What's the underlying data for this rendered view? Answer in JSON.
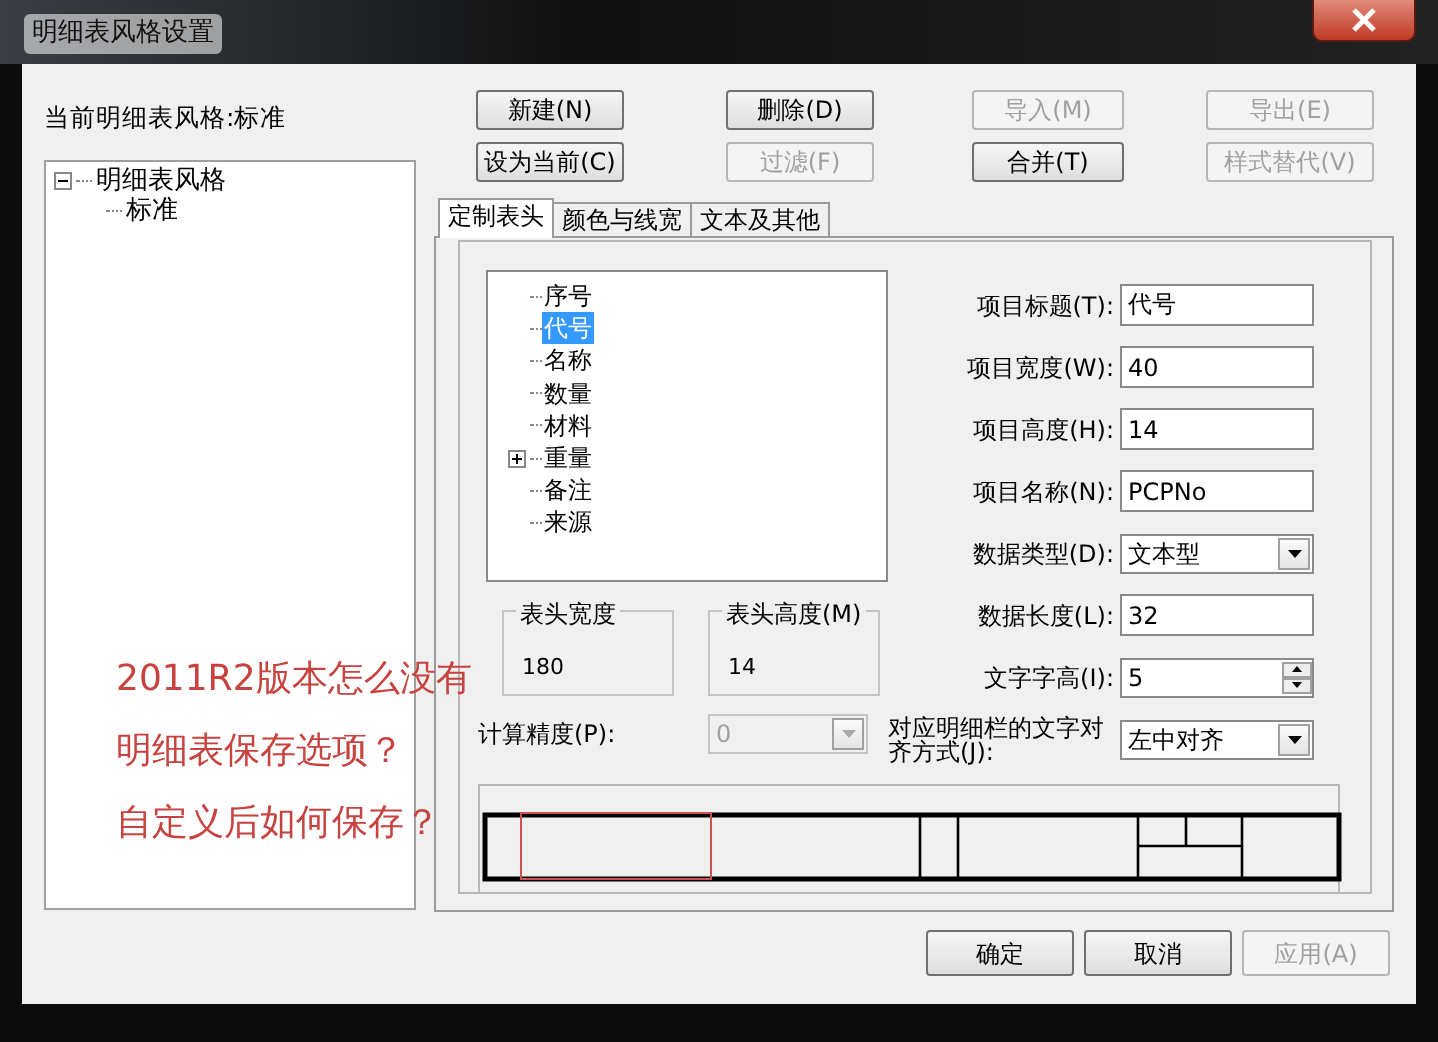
{
  "window": {
    "title": "明细表风格设置"
  },
  "current_style_label": "当前明细表风格:标准",
  "style_tree": [
    {
      "label": "明细表风格",
      "expanded": true,
      "selected": false,
      "children": [
        {
          "label": "标准",
          "selected": false
        }
      ]
    }
  ],
  "toolbar_buttons": [
    {
      "label": "新建(N)",
      "disabled": false
    },
    {
      "label": "删除(D)",
      "disabled": false
    },
    {
      "label": "导入(M)",
      "disabled": true
    },
    {
      "label": "导出(E)",
      "disabled": true
    },
    {
      "label": "设为当前(C)",
      "disabled": false
    },
    {
      "label": "过滤(F)",
      "disabled": true
    },
    {
      "label": "合并(T)",
      "disabled": false
    },
    {
      "label": "样式替代(V)",
      "disabled": true
    }
  ],
  "tabs": [
    {
      "label": "定制表头",
      "selected": true
    },
    {
      "label": "颜色与线宽",
      "selected": false
    },
    {
      "label": "文本及其他",
      "selected": false
    }
  ],
  "field_tree": [
    {
      "label": "序号",
      "selected": false,
      "collapsed": false
    },
    {
      "label": "代号",
      "selected": true,
      "collapsed": false
    },
    {
      "label": "名称",
      "selected": false,
      "collapsed": false
    },
    {
      "label": "数量",
      "selected": false,
      "collapsed": false
    },
    {
      "label": "材料",
      "selected": false,
      "collapsed": false
    },
    {
      "label": "重量",
      "selected": false,
      "collapsed": true
    },
    {
      "label": "备注",
      "selected": false,
      "collapsed": false
    },
    {
      "label": "来源",
      "selected": false,
      "collapsed": false
    }
  ],
  "properties": [
    {
      "kind": "text",
      "label": "项目标题(T):",
      "value": "代号"
    },
    {
      "kind": "text",
      "label": "项目宽度(W):",
      "value": "40"
    },
    {
      "kind": "text",
      "label": "项目高度(H):",
      "value": "14"
    },
    {
      "kind": "text",
      "label": "项目名称(N):",
      "value": "PCPNo"
    },
    {
      "kind": "combo",
      "label": "数据类型(D):",
      "value": "文本型"
    },
    {
      "kind": "text",
      "label": "数据长度(L):",
      "value": "32"
    },
    {
      "kind": "spin",
      "label": "文字字高(I):",
      "value": "5"
    },
    {
      "kind": "combo",
      "label": "对应明细栏的文字对齐方式(J):",
      "value": "左中对齐"
    }
  ],
  "header_width": {
    "label": "表头宽度",
    "value": "180"
  },
  "header_height": {
    "label": "表头高度(M)",
    "value": "14"
  },
  "precision": {
    "label": "计算精度(P):",
    "value": "0",
    "disabled": true
  },
  "annotation": {
    "lines": [
      "2011R2版本怎么没有",
      "明细表保存选项？",
      "自定义后如何保存？"
    ]
  },
  "footer_buttons": [
    {
      "label": "确定",
      "disabled": false
    },
    {
      "label": "取消",
      "disabled": false
    },
    {
      "label": "应用(A)",
      "disabled": true
    }
  ]
}
